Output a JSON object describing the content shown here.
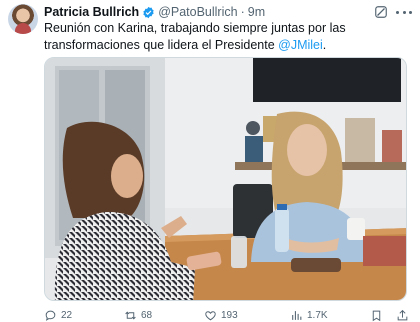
{
  "author": {
    "name": "Patricia Bullrich",
    "handle": "@PatoBullrich",
    "separator": "·",
    "time": "9m"
  },
  "tweet": {
    "text_before": "Reunión con Karina, trabajando siempre juntas por las transformaciones que lidera el Presidente ",
    "mention": "@JMilei",
    "text_after": "."
  },
  "metrics": {
    "replies": "22",
    "reposts": "68",
    "likes": "193",
    "views": "1.7K"
  },
  "colors": {
    "accent": "#1d9bf0",
    "text": "#0f1419",
    "muted": "#536471"
  },
  "icons": [
    "verified-badge-icon",
    "grok-icon",
    "more-icon",
    "reply-icon",
    "repost-icon",
    "like-icon",
    "views-icon",
    "bookmark-icon",
    "share-icon"
  ]
}
